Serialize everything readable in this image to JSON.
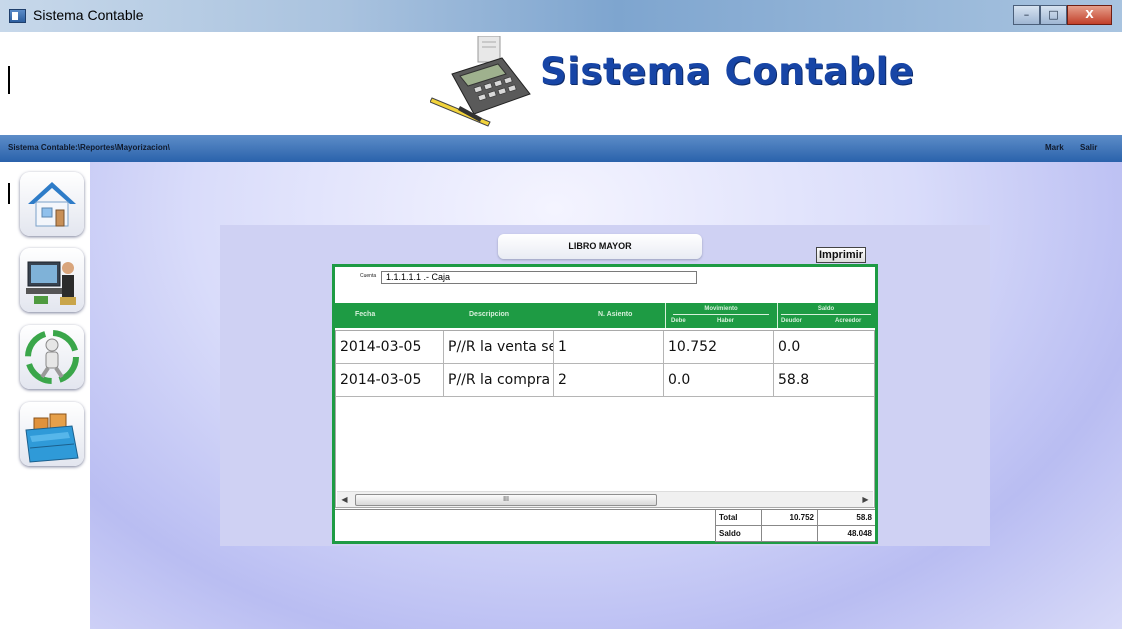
{
  "window": {
    "title": "Sistema Contable",
    "buttons": {
      "minimize": "–",
      "maximize": "□",
      "close": "X"
    }
  },
  "header": {
    "brand": "Sistema Contable"
  },
  "navbar": {
    "path": "Sistema Contable:\\Reportes\\Mayorizacion\\",
    "user": "Mark",
    "logout": "Salir"
  },
  "sidebar": {
    "items": [
      {
        "icon": "home-icon"
      },
      {
        "icon": "accounting-user-icon"
      },
      {
        "icon": "recycle-person-icon"
      },
      {
        "icon": "file-cabinet-icon"
      }
    ]
  },
  "report": {
    "title": "LIBRO MAYOR",
    "print_label": "Imprimir",
    "account_label": "Cuenta",
    "account_value": "1.1.1.1.1 .- Caja",
    "columns": {
      "fecha": "Fecha",
      "descripcion": "Descripcion",
      "asiento": "N. Asiento",
      "movimiento": "Movimiento",
      "debe": "Debe",
      "haber": "Haber",
      "saldo": "Saldo",
      "deudor": "Deudor",
      "acreedor": "Acreedor"
    },
    "rows": [
      {
        "fecha": "2014-03-05",
        "descripcion": "P//R la venta se...",
        "asiento": "1",
        "movimiento": "10.752",
        "saldo": "0.0"
      },
      {
        "fecha": "2014-03-05",
        "descripcion": "P//R la compra ...",
        "asiento": "2",
        "movimiento": "0.0",
        "saldo": "58.8"
      }
    ],
    "scroll": {
      "left": "◀",
      "right": "▶",
      "thumb": "III"
    },
    "totals": {
      "total_label": "Total",
      "total_debe": "10.752",
      "total_haber": "58.8",
      "saldo_label": "Saldo",
      "saldo_value": "48.048"
    }
  },
  "colors": {
    "brand": "#1745a6",
    "navbar": "#2a62ab",
    "table_header": "#1e9b44"
  }
}
